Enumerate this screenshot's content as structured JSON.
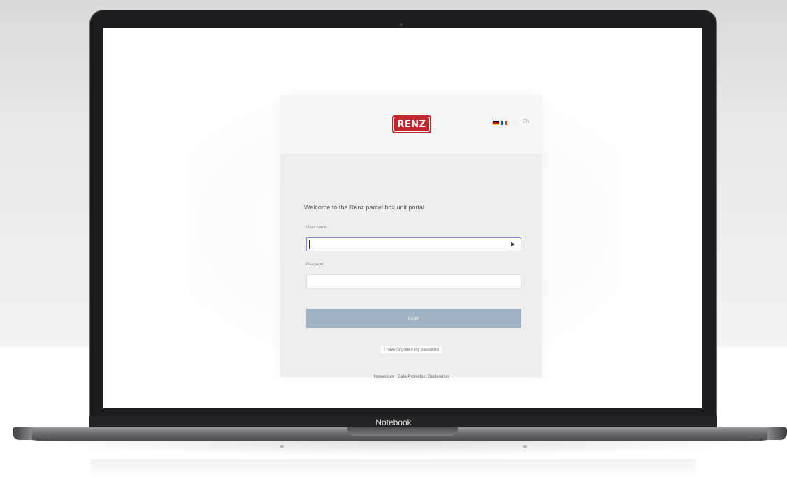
{
  "device": {
    "label": "Notebook"
  },
  "login": {
    "logo_text": "RENZ",
    "language_label": "EN",
    "title": "Welcome to the Renz parcel box unit portal",
    "user_label": "User name",
    "user_value": "",
    "password_label": "Password",
    "password_value": "",
    "login_button": "Login",
    "forgot_link": "I have forgotten my password",
    "privacy_link": "Impressum | Data Protection Declaration"
  },
  "colors": {
    "brand_red": "#c1272d",
    "button_blue": "#9fb3c4",
    "focus_border": "#7a8fc9"
  },
  "icons": {
    "language": "globe-icon",
    "input_action": "arrow-right-icon"
  }
}
